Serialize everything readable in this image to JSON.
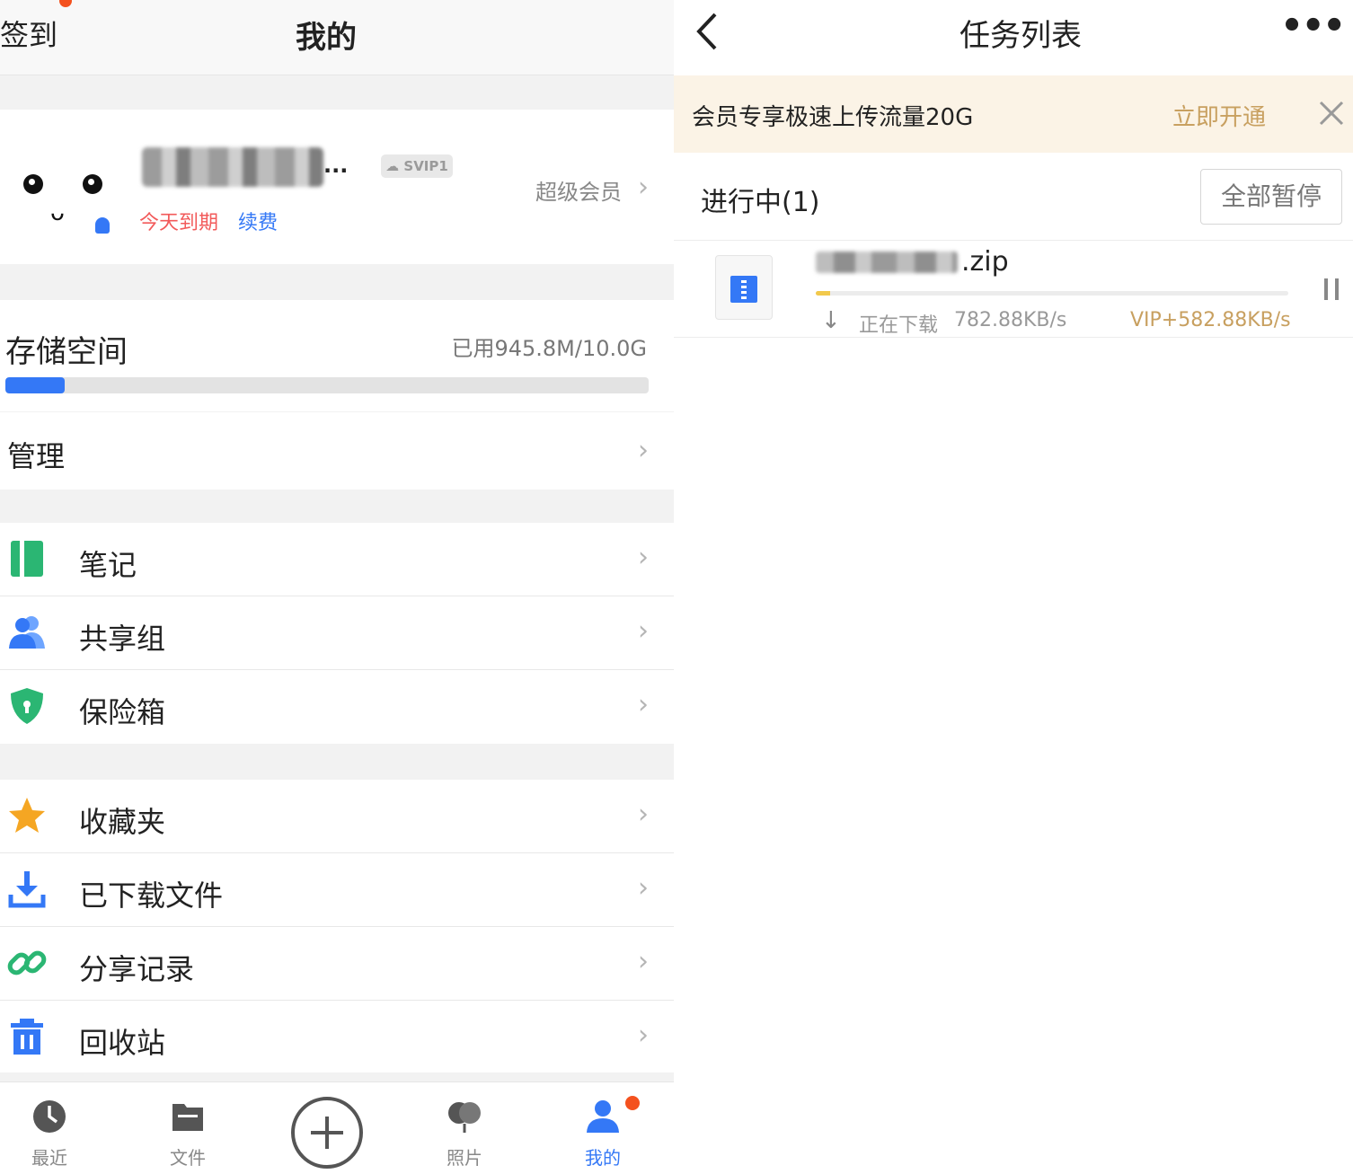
{
  "left": {
    "header": {
      "checkin_label": "签到",
      "title": "我的"
    },
    "profile": {
      "vip_badge": "SVIP1",
      "expire_text": "今天到期",
      "renew_text": "续费",
      "member_link": "超级会员"
    },
    "storage": {
      "label": "存储空间",
      "used_text": "已用945.8M/10.0G",
      "used_fraction": 0.092,
      "manage_label": "管理"
    },
    "menu_group1": [
      {
        "label": "笔记",
        "icon": "note-icon"
      },
      {
        "label": "共享组",
        "icon": "group-icon"
      },
      {
        "label": "保险箱",
        "icon": "shield-icon"
      }
    ],
    "menu_group2": [
      {
        "label": "收藏夹",
        "icon": "star-icon"
      },
      {
        "label": "已下载文件",
        "icon": "download-icon"
      },
      {
        "label": "分享记录",
        "icon": "link-icon"
      },
      {
        "label": "回收站",
        "icon": "trash-icon"
      }
    ],
    "tabs": [
      {
        "label": "最近",
        "icon": "clock-icon"
      },
      {
        "label": "文件",
        "icon": "folder-icon"
      },
      {
        "label": "照片",
        "icon": "photo-icon"
      },
      {
        "label": "我的",
        "icon": "person-icon",
        "active": true
      }
    ]
  },
  "right": {
    "header": {
      "title": "任务列表",
      "more": "•••"
    },
    "banner": {
      "message": "会员专享极速上传流量20G",
      "action": "立即开通"
    },
    "section": {
      "label": "进行中(1)",
      "pause_all": "全部暂停"
    },
    "task": {
      "extension": ".zip",
      "progress_fraction": 0.03,
      "status": "正在下载",
      "speed": "782.88KB/s",
      "vip_speed": "VIP+582.88KB/s"
    }
  },
  "colors": {
    "accent": "#3478f6",
    "gold": "#c8a060",
    "red": "#f4511e",
    "expire": "#f25a5a"
  }
}
